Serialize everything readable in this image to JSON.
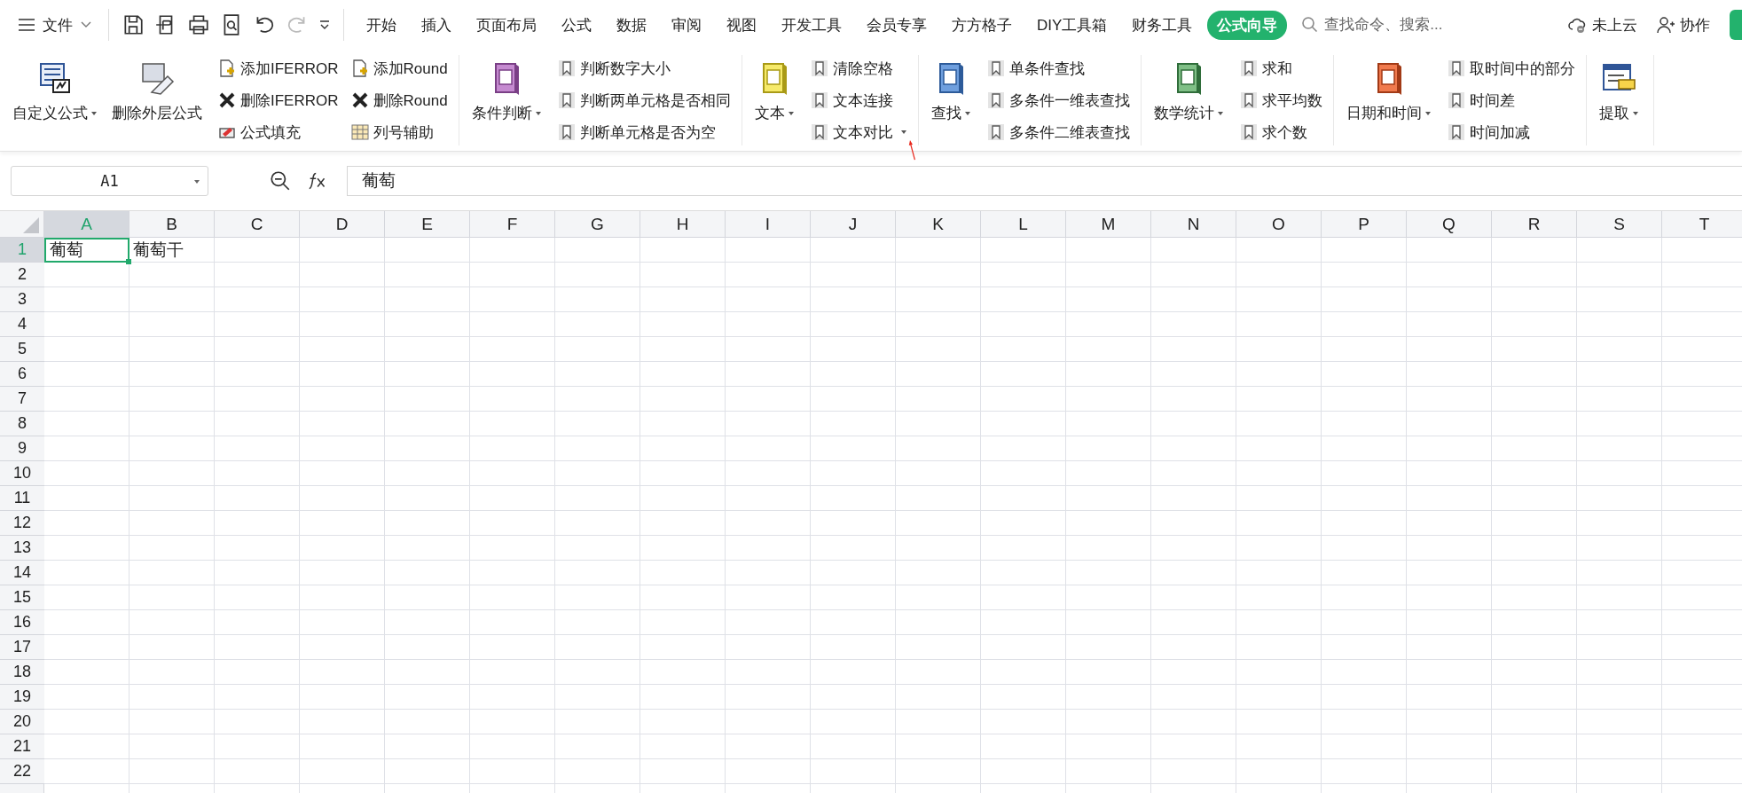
{
  "menu_bar": {
    "file_menu": "文件",
    "tabs": [
      {
        "label": "开始",
        "selected": false
      },
      {
        "label": "插入",
        "selected": false
      },
      {
        "label": "页面布局",
        "selected": false
      },
      {
        "label": "公式",
        "selected": false
      },
      {
        "label": "数据",
        "selected": false
      },
      {
        "label": "审阅",
        "selected": false
      },
      {
        "label": "视图",
        "selected": false
      },
      {
        "label": "开发工具",
        "selected": false
      },
      {
        "label": "会员专享",
        "selected": false
      },
      {
        "label": "方方格子",
        "selected": false
      },
      {
        "label": "DIY工具箱",
        "selected": false
      },
      {
        "label": "财务工具",
        "selected": false
      },
      {
        "label": "公式向导",
        "selected": true
      }
    ],
    "search": {
      "placeholder": "查找命令、搜索..."
    },
    "cloud_status": "未上云",
    "collaborate": "协作"
  },
  "ribbon": {
    "groups": [
      {
        "large": [
          {
            "label": "自定义公式",
            "dropdown": true
          },
          {
            "label": "删除外层公式",
            "dropdown": false
          }
        ],
        "columns": [
          [
            {
              "label": "添加IFERROR",
              "dropdown": false
            },
            {
              "label": "删除IFERROR",
              "dropdown": false
            },
            {
              "label": "公式填充",
              "dropdown": false
            }
          ],
          [
            {
              "label": "添加Round",
              "dropdown": false
            },
            {
              "label": "删除Round",
              "dropdown": false
            },
            {
              "label": "列号辅助",
              "dropdown": false
            }
          ]
        ]
      },
      {
        "large": [
          {
            "label": "条件判断",
            "dropdown": true
          }
        ],
        "columns": [
          [
            {
              "label": "判断数字大小",
              "dropdown": false
            },
            {
              "label": "判断两单元格是否相同",
              "dropdown": false
            },
            {
              "label": "判断单元格是否为空",
              "dropdown": false
            }
          ]
        ]
      },
      {
        "large": [
          {
            "label": "文本",
            "dropdown": true
          }
        ],
        "columns": [
          [
            {
              "label": "清除空格",
              "dropdown": false
            },
            {
              "label": "文本连接",
              "dropdown": false
            },
            {
              "label": "文本对比",
              "dropdown": true
            }
          ]
        ]
      },
      {
        "large": [
          {
            "label": "查找",
            "dropdown": true
          }
        ],
        "columns": [
          [
            {
              "label": "单条件查找",
              "dropdown": false
            },
            {
              "label": "多条件一维表查找",
              "dropdown": false
            },
            {
              "label": "多条件二维表查找",
              "dropdown": false
            }
          ]
        ]
      },
      {
        "large": [
          {
            "label": "数学统计",
            "dropdown": true
          }
        ],
        "columns": [
          [
            {
              "label": "求和",
              "dropdown": false
            },
            {
              "label": "求平均数",
              "dropdown": false
            },
            {
              "label": "求个数",
              "dropdown": false
            }
          ]
        ]
      },
      {
        "large": [
          {
            "label": "日期和时间",
            "dropdown": true
          }
        ],
        "columns": [
          [
            {
              "label": "取时间中的部分",
              "dropdown": false
            },
            {
              "label": "时间差",
              "dropdown": false
            },
            {
              "label": "时间加减",
              "dropdown": false
            }
          ]
        ]
      },
      {
        "large": [
          {
            "label": "提取",
            "dropdown": true
          }
        ]
      }
    ]
  },
  "formula_bar": {
    "name_box": "A1",
    "formula": "葡萄"
  },
  "sheet": {
    "columns": [
      {
        "label": "A",
        "selected": true
      },
      {
        "label": "B",
        "selected": false
      },
      {
        "label": "C",
        "selected": false
      },
      {
        "label": "D",
        "selected": false
      },
      {
        "label": "E",
        "selected": false
      },
      {
        "label": "F",
        "selected": false
      },
      {
        "label": "G",
        "selected": false
      },
      {
        "label": "H",
        "selected": false
      },
      {
        "label": "I",
        "selected": false
      },
      {
        "label": "J",
        "selected": false
      },
      {
        "label": "K",
        "selected": false
      },
      {
        "label": "L",
        "selected": false
      },
      {
        "label": "M",
        "selected": false
      },
      {
        "label": "N",
        "selected": false
      },
      {
        "label": "O",
        "selected": false
      },
      {
        "label": "P",
        "selected": false
      },
      {
        "label": "Q",
        "selected": false
      },
      {
        "label": "R",
        "selected": false
      },
      {
        "label": "S",
        "selected": false
      },
      {
        "label": "T",
        "selected": false
      }
    ],
    "rows": [
      {
        "label": "1",
        "selected": true,
        "cells": [
          {
            "text": "葡萄",
            "selected": true
          },
          {
            "text": "葡萄干",
            "selected": false
          }
        ]
      },
      {
        "label": "2",
        "selected": false
      },
      {
        "label": "3",
        "selected": false
      },
      {
        "label": "4",
        "selected": false
      },
      {
        "label": "5",
        "selected": false
      },
      {
        "label": "6",
        "selected": false
      },
      {
        "label": "7",
        "selected": false
      },
      {
        "label": "8",
        "selected": false
      },
      {
        "label": "9",
        "selected": false
      },
      {
        "label": "10",
        "selected": false
      },
      {
        "label": "11",
        "selected": false
      },
      {
        "label": "12",
        "selected": false
      },
      {
        "label": "13",
        "selected": false
      },
      {
        "label": "14",
        "selected": false
      },
      {
        "label": "15",
        "selected": false
      },
      {
        "label": "16",
        "selected": false
      },
      {
        "label": "17",
        "selected": false
      },
      {
        "label": "18",
        "selected": false
      },
      {
        "label": "19",
        "selected": false
      },
      {
        "label": "20",
        "selected": false
      },
      {
        "label": "21",
        "selected": false
      },
      {
        "label": "22",
        "selected": false
      }
    ]
  }
}
